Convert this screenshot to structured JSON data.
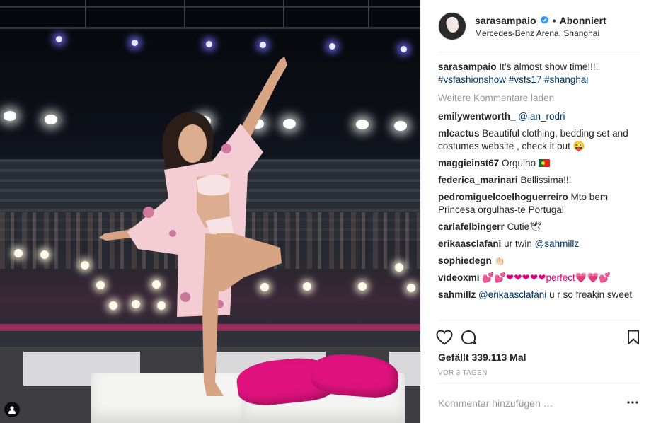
{
  "post": {
    "username": "sarasampaio",
    "follow_state": "Abonniert",
    "location": "Mercedes-Benz Arena, Shanghai",
    "caption": {
      "user": "sarasampaio",
      "text": "It’s almost show time!!!!",
      "hashtags": "#vsfashionshow #vsfs17 #shanghai"
    },
    "load_more": "Weitere Kommentare laden",
    "comments": [
      {
        "user": "emilywentworth_",
        "text": "",
        "mention": "@ian_rodri",
        "tail": ""
      },
      {
        "user": "mlcactus",
        "text": "Beautiful clothing, bedding set and costumes website , check it out 😜",
        "mention": "",
        "tail": ""
      },
      {
        "user": "maggieinst67",
        "text": "Orgulho",
        "mention": "",
        "tail": ""
      },
      {
        "user": "federica_marinari",
        "text": "Bellissima!!!",
        "mention": "",
        "tail": ""
      },
      {
        "user": "pedromiguelcoelhoguerreiro",
        "text": "Mto bem Princesa orgulhas-te Portugal",
        "mention": "",
        "tail": ""
      },
      {
        "user": "carlafelbingerr",
        "text": "Cutie🕊",
        "mention": "",
        "tail": ""
      },
      {
        "user": "erikaasclafani",
        "text": "ur twin",
        "mention": "@sahmillz",
        "tail": ""
      },
      {
        "user": "sophiedegn",
        "text": "👏🏻",
        "mention": "",
        "tail": ""
      },
      {
        "user": "videoxmi",
        "text": "💕💕❤❤❤❤❤perfect💗💗💕",
        "mention": "",
        "tail": ""
      },
      {
        "user": "sahmillz",
        "text": "",
        "mention": "@erikaasclafani",
        "tail": "u r so freakin sweet"
      }
    ],
    "likes": "Gefällt 339.113 Mal",
    "time": "VOR 3 TAGEN",
    "add_comment_placeholder": "Kommentar hinzufügen …",
    "colors": {
      "link": "#003569",
      "verified": "#3897f0",
      "muted": "#999999"
    },
    "icons": [
      "user-tag-icon",
      "verified-badge-icon",
      "heart-icon",
      "comment-icon",
      "bookmark-icon",
      "more-options-icon"
    ]
  }
}
